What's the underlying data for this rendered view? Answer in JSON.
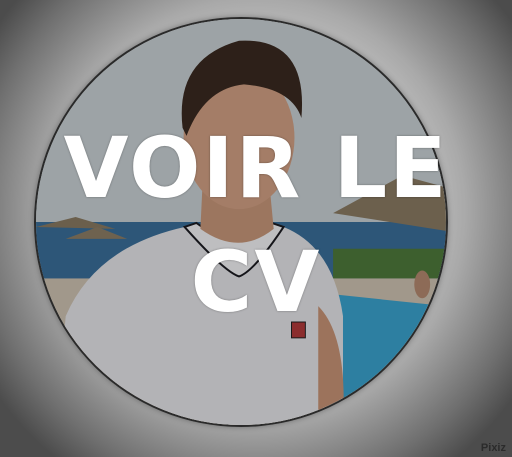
{
  "overlay": {
    "line1": "VOIR LE",
    "line2": "CV"
  },
  "watermark": {
    "text": "Pixiz"
  },
  "colors": {
    "text": "#ffffff",
    "ring": "#2a2a2a",
    "vignette_dark": "#4c4c4c",
    "sky": "#c9d2d6",
    "sea": "#2f6fa3",
    "pool": "#3aa7d6",
    "shirt": "#e8e8ec"
  }
}
